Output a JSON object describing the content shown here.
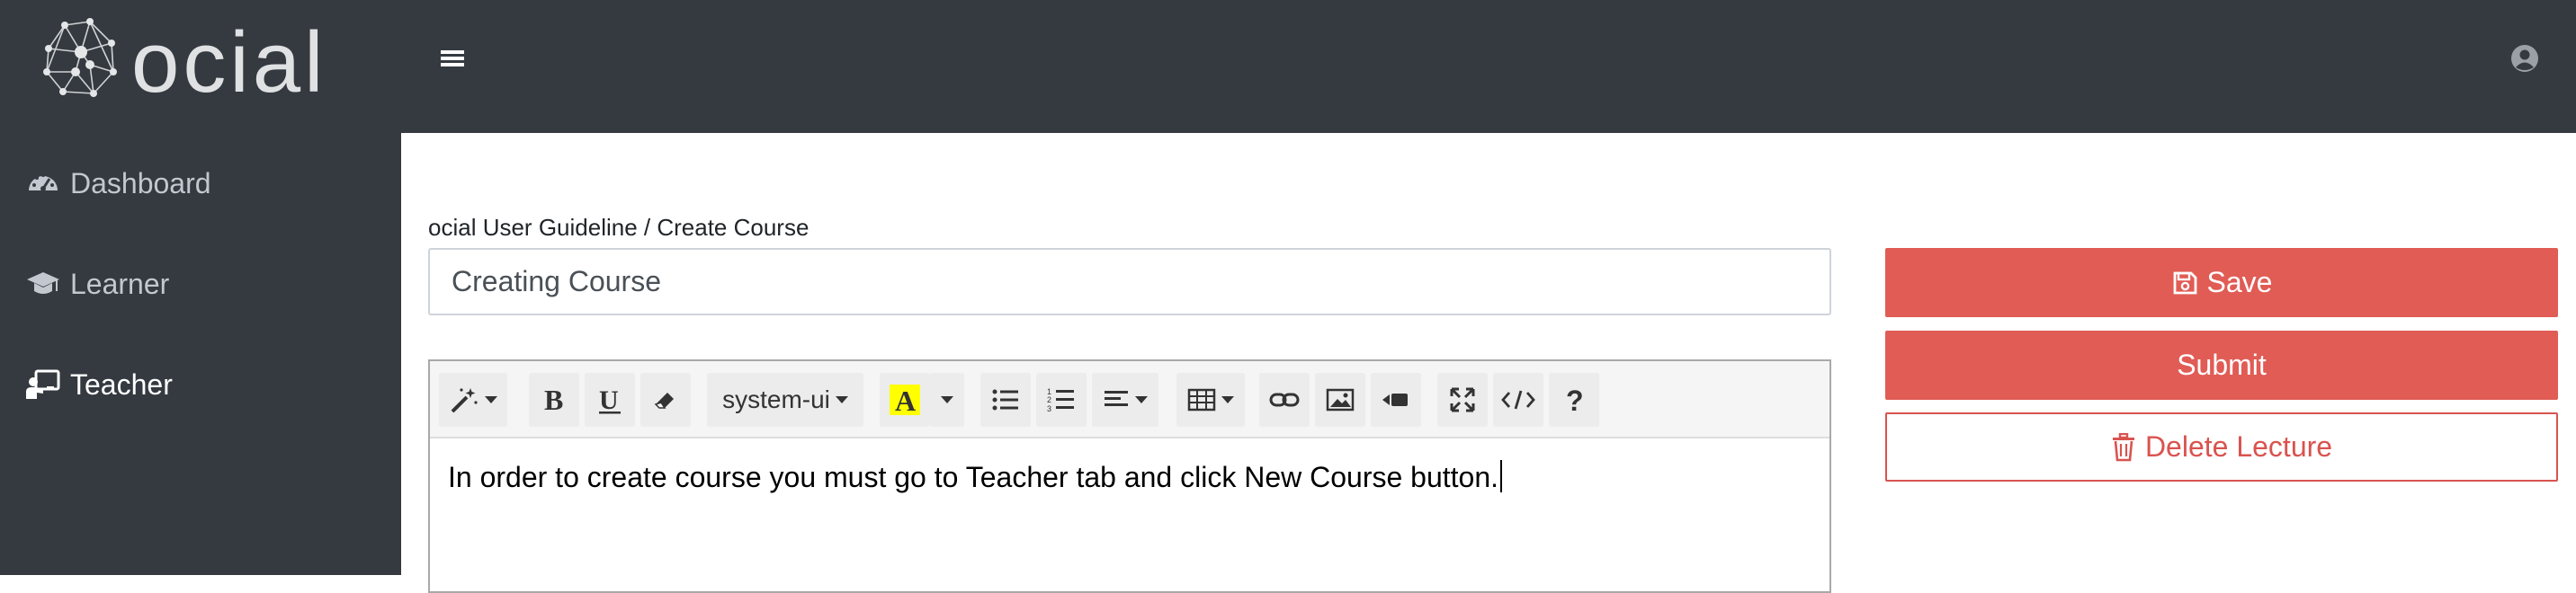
{
  "header": {
    "logo_text": "ocial",
    "menu_icon": "hamburger-icon",
    "user_icon": "user-circle-icon"
  },
  "sidebar": {
    "items": [
      {
        "label": "Dashboard",
        "icon": "tachometer-icon",
        "active": false
      },
      {
        "label": "Learner",
        "icon": "graduation-cap-icon",
        "active": false
      },
      {
        "label": "Teacher",
        "icon": "chalkboard-teacher-icon",
        "active": true
      }
    ]
  },
  "main": {
    "breadcrumb": "ocial User Guideline / Create Course",
    "title_value": "Creating Course",
    "editor": {
      "font_name": "system-ui",
      "content": "In order to create course you must go to Teacher tab and click New Course button."
    }
  },
  "actions": {
    "save_label": "Save",
    "submit_label": "Submit",
    "delete_label": "Delete Lecture"
  },
  "colors": {
    "topbar": "#343a40",
    "sidebar": "#343a40",
    "accent": "#e05c55",
    "danger": "#d9534f"
  }
}
